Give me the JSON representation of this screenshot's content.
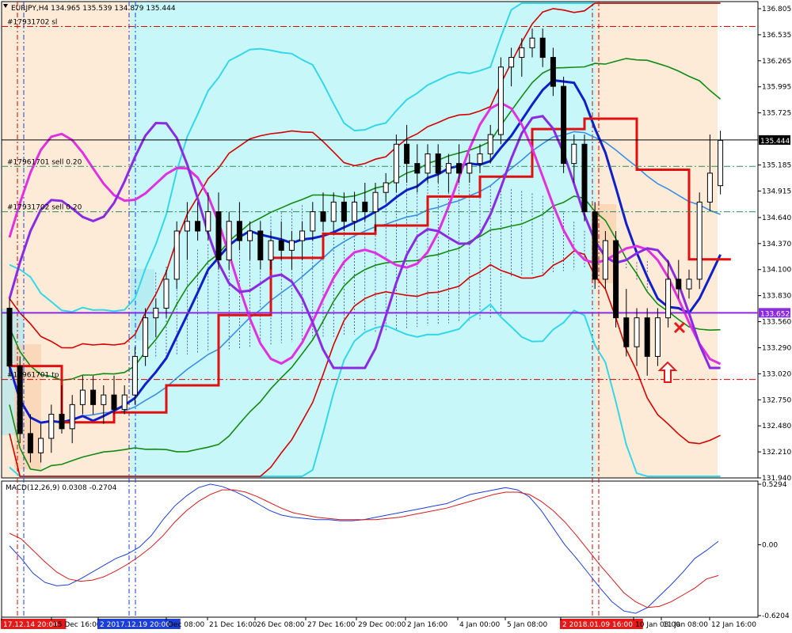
{
  "chart_data": {
    "type": "candlestick",
    "symbol_line": "EURJPY,H4  134.965 135.539 134.879 135.444",
    "price_axis": {
      "range": [
        131.94,
        136.805
      ],
      "ticks": [
        136.805,
        136.535,
        136.265,
        135.995,
        135.725,
        135.185,
        134.915,
        134.64,
        134.37,
        134.1,
        133.83,
        133.56,
        133.29,
        133.02,
        132.75,
        132.48,
        132.21,
        131.94
      ],
      "tick_labels": [
        "136.805",
        "136.535",
        "136.265",
        "135.995",
        "135.725",
        "135.185",
        "134.915",
        "134.640",
        "134.370",
        "134.100",
        "133.830",
        "133.560",
        "133.290",
        "133.020",
        "132.750",
        "132.480",
        "132.210",
        "131.940"
      ],
      "current_price": "135.444",
      "marked_level": "133.652",
      "colors": {
        "current": "#000000",
        "marked": "#8a2be2"
      }
    },
    "horizontal_levels": [
      {
        "label": "#17961701 sell 0.20",
        "price": 135.17,
        "color": "#2e8b57",
        "style": "dashdot"
      },
      {
        "label": "#17931702 sell 0.20",
        "price": 134.7,
        "color": "#2e8b57",
        "style": "dashdot"
      },
      {
        "label": "#17931702 sl",
        "price": 136.62,
        "color": "#d40000",
        "style": "dashdot"
      },
      {
        "label": "#17961701 tp",
        "price": 132.96,
        "color": "#d40000",
        "style": "dashdot"
      }
    ],
    "ohlc": [
      [
        133.7,
        133.8,
        133.0,
        133.1
      ],
      [
        133.1,
        133.2,
        132.3,
        132.4
      ],
      [
        132.4,
        132.6,
        132.1,
        132.2
      ],
      [
        132.2,
        132.5,
        132.1,
        132.35
      ],
      [
        132.35,
        132.7,
        132.2,
        132.6
      ],
      [
        132.6,
        132.9,
        132.4,
        132.45
      ],
      [
        132.45,
        132.8,
        132.3,
        132.7
      ],
      [
        132.7,
        133.0,
        132.6,
        132.85
      ],
      [
        132.85,
        133.0,
        132.6,
        132.7
      ],
      [
        132.7,
        132.9,
        132.5,
        132.8
      ],
      [
        132.8,
        133.0,
        132.6,
        132.65
      ],
      [
        132.65,
        132.9,
        132.6,
        132.8
      ],
      [
        132.8,
        133.3,
        132.7,
        133.2
      ],
      [
        133.2,
        133.7,
        133.1,
        133.6
      ],
      [
        133.6,
        133.8,
        133.4,
        133.7
      ],
      [
        133.7,
        134.1,
        133.6,
        134.0
      ],
      [
        134.0,
        134.6,
        133.9,
        134.5
      ],
      [
        134.5,
        134.8,
        134.2,
        134.6
      ],
      [
        134.6,
        134.8,
        134.4,
        134.5
      ],
      [
        134.5,
        134.9,
        134.4,
        134.7
      ],
      [
        134.7,
        134.9,
        134.1,
        134.2
      ],
      [
        134.2,
        134.7,
        134.1,
        134.6
      ],
      [
        134.6,
        134.8,
        134.3,
        134.4
      ],
      [
        134.4,
        134.6,
        134.2,
        134.5
      ],
      [
        134.5,
        134.6,
        134.1,
        134.2
      ],
      [
        134.2,
        134.5,
        134.1,
        134.4
      ],
      [
        134.4,
        134.6,
        134.2,
        134.3
      ],
      [
        134.3,
        134.5,
        134.1,
        134.4
      ],
      [
        134.4,
        134.6,
        134.2,
        134.5
      ],
      [
        134.5,
        134.8,
        134.4,
        134.7
      ],
      [
        134.7,
        134.9,
        134.5,
        134.6
      ],
      [
        134.6,
        134.9,
        134.5,
        134.8
      ],
      [
        134.8,
        134.9,
        134.5,
        134.6
      ],
      [
        134.6,
        134.9,
        134.5,
        134.8
      ],
      [
        134.8,
        135.0,
        134.6,
        134.7
      ],
      [
        134.7,
        135.0,
        134.5,
        134.9
      ],
      [
        134.9,
        135.1,
        134.8,
        135.0
      ],
      [
        135.0,
        135.5,
        134.9,
        135.4
      ],
      [
        135.4,
        135.6,
        135.0,
        135.2
      ],
      [
        135.2,
        135.4,
        134.9,
        135.1
      ],
      [
        135.1,
        135.4,
        135.0,
        135.3
      ],
      [
        135.3,
        135.4,
        135.0,
        135.1
      ],
      [
        135.1,
        135.3,
        134.9,
        135.2
      ],
      [
        135.2,
        135.4,
        135.0,
        135.1
      ],
      [
        135.1,
        135.3,
        135.0,
        135.2
      ],
      [
        135.2,
        135.4,
        135.1,
        135.3
      ],
      [
        135.3,
        135.6,
        135.2,
        135.5
      ],
      [
        135.5,
        136.3,
        135.4,
        136.2
      ],
      [
        136.2,
        136.4,
        136.0,
        136.3
      ],
      [
        136.3,
        136.5,
        136.1,
        136.4
      ],
      [
        136.4,
        136.6,
        136.3,
        136.5
      ],
      [
        136.5,
        136.6,
        136.2,
        136.3
      ],
      [
        136.3,
        136.4,
        135.9,
        136.0
      ],
      [
        136.0,
        136.1,
        135.1,
        135.2
      ],
      [
        135.2,
        135.5,
        135.0,
        135.4
      ],
      [
        135.4,
        135.5,
        134.6,
        134.7
      ],
      [
        134.7,
        134.8,
        133.9,
        134.0
      ],
      [
        134.0,
        134.5,
        133.9,
        134.4
      ],
      [
        134.4,
        134.5,
        133.5,
        133.6
      ],
      [
        133.6,
        133.9,
        133.2,
        133.3
      ],
      [
        133.3,
        133.7,
        133.1,
        133.6
      ],
      [
        133.6,
        133.7,
        133.0,
        133.2
      ],
      [
        133.2,
        133.7,
        133.1,
        133.6
      ],
      [
        133.6,
        134.2,
        133.5,
        134.0
      ],
      [
        134.0,
        134.2,
        133.8,
        133.9
      ],
      [
        133.9,
        134.1,
        133.8,
        134.0
      ],
      [
        134.0,
        134.9,
        133.9,
        134.8
      ],
      [
        134.8,
        135.5,
        134.7,
        135.1
      ],
      [
        134.97,
        135.54,
        134.88,
        135.44
      ]
    ],
    "x_axis_labels": [
      "17.12.14 20:00",
      "15 Dec 16:00",
      "2 2017.12.19 20:00",
      "Dec 08:00",
      "21 Dec 16:00",
      "26 Dec 08:00",
      "27 Dec 16:00",
      "29 Dec 00:00",
      "2 Jan 16:00",
      "4 Jan 00:00",
      "5 Jan 08:00",
      "2 2018.01.09 16:00",
      "10 Jan 08:00",
      "11 Jan 08:00",
      "12 Jan 16:00"
    ],
    "macd": {
      "label": "MACD(12,26,9) 0.0308 -0.2704",
      "ticks": [
        "0.5294",
        "0.00",
        "-0.6204"
      ],
      "range": [
        -0.6204,
        0.5294
      ],
      "macd_line": [
        -0.01,
        -0.12,
        -0.25,
        -0.33,
        -0.36,
        -0.35,
        -0.3,
        -0.24,
        -0.18,
        -0.12,
        -0.08,
        -0.02,
        0.08,
        0.22,
        0.34,
        0.43,
        0.5,
        0.53,
        0.51,
        0.47,
        0.42,
        0.36,
        0.3,
        0.26,
        0.24,
        0.23,
        0.22,
        0.22,
        0.21,
        0.21,
        0.22,
        0.24,
        0.26,
        0.28,
        0.3,
        0.32,
        0.34,
        0.36,
        0.4,
        0.44,
        0.46,
        0.48,
        0.5,
        0.48,
        0.42,
        0.3,
        0.15,
        0.0,
        -0.12,
        -0.25,
        -0.38,
        -0.5,
        -0.58,
        -0.6,
        -0.55,
        -0.45,
        -0.35,
        -0.24,
        -0.12,
        -0.05,
        0.03
      ],
      "signal_line": [
        0.1,
        0.05,
        -0.05,
        -0.15,
        -0.24,
        -0.3,
        -0.32,
        -0.31,
        -0.28,
        -0.23,
        -0.17,
        -0.1,
        -0.02,
        0.08,
        0.2,
        0.3,
        0.38,
        0.44,
        0.48,
        0.48,
        0.46,
        0.42,
        0.37,
        0.32,
        0.28,
        0.26,
        0.24,
        0.23,
        0.22,
        0.22,
        0.22,
        0.22,
        0.23,
        0.24,
        0.26,
        0.28,
        0.3,
        0.32,
        0.35,
        0.38,
        0.41,
        0.44,
        0.46,
        0.46,
        0.44,
        0.38,
        0.3,
        0.2,
        0.08,
        -0.05,
        -0.18,
        -0.3,
        -0.42,
        -0.5,
        -0.55,
        -0.54,
        -0.5,
        -0.44,
        -0.38,
        -0.3,
        -0.27
      ],
      "colors": {
        "macd": "#1d3fd6",
        "signal": "#d41a1a"
      }
    },
    "sell_arrow_label": "",
    "colors": {
      "cloud_cyan": "#c8f7f9",
      "orange_zone": "#fdebd7",
      "ichimoku_hatch": "#000080",
      "bull": "#ffffff",
      "bear": "#000000"
    }
  }
}
